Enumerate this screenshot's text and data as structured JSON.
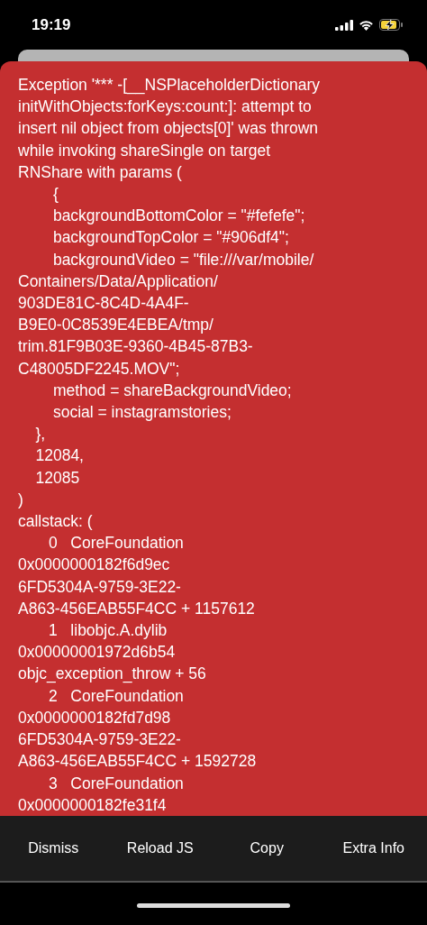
{
  "status_bar": {
    "time": "19:19",
    "charging": true
  },
  "error_lines": [
    "Exception '*** -[__NSPlaceholderDictionary",
    "initWithObjects:forKeys:count:]: attempt to",
    "insert nil object from objects[0]' was thrown",
    "while invoking shareSingle on target",
    "RNShare with params (",
    "        {",
    "        backgroundBottomColor = \"#fefefe\";",
    "        backgroundTopColor = \"#906df4\";",
    "        backgroundVideo = \"file:///var/mobile/",
    "Containers/Data/Application/",
    "903DE81C-8C4D-4A4F-",
    "B9E0-0C8539E4EBEA/tmp/",
    "trim.81F9B03E-9360-4B45-87B3-",
    "C48005DF2245.MOV\";",
    "        method = shareBackgroundVideo;",
    "        social = instagramstories;",
    "    },",
    "    12084,",
    "    12085",
    ")",
    "callstack: (",
    "       0   CoreFoundation",
    "0x0000000182f6d9ec",
    "6FD5304A-9759-3E22-",
    "A863-456EAB55F4CC + 1157612",
    "       1   libobjc.A.dylib",
    "0x00000001972d6b54",
    "objc_exception_throw + 56",
    "       2   CoreFoundation",
    "0x0000000182fd7d98",
    "6FD5304A-9759-3E22-",
    "A863-456EAB55F4CC + 1592728",
    "       3   CoreFoundation",
    "0x0000000182fe31f4"
  ],
  "buttons": [
    "Dismiss",
    "Reload JS",
    "Copy",
    "Extra Info"
  ]
}
